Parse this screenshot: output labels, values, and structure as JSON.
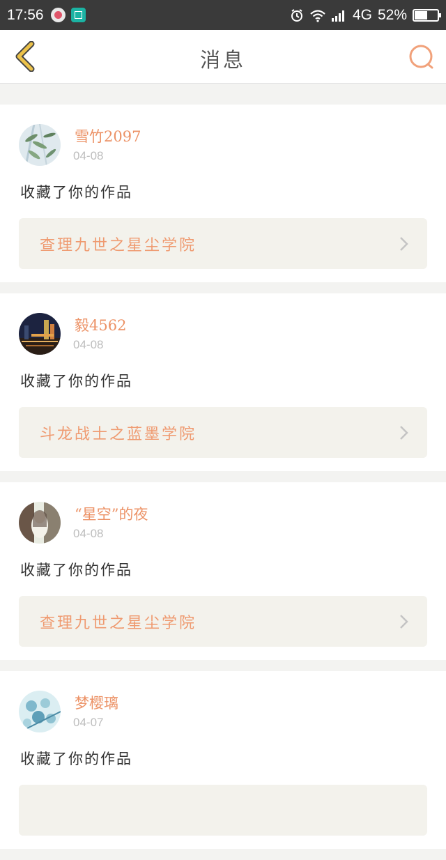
{
  "status_bar": {
    "time": "17:56",
    "network": "4G",
    "battery": "52%"
  },
  "nav": {
    "title": "消息"
  },
  "colors": {
    "accent": "#ec9266",
    "back_arrow": "#ecc24a",
    "search_icon": "#f1a17a"
  },
  "messages": [
    {
      "username": "雪竹2097",
      "date": "04-08",
      "action": "收藏了你的作品",
      "work": "查理九世之星尘学院",
      "avatar_icon": "bamboo-avatar"
    },
    {
      "username": "毅4562",
      "date": "04-08",
      "action": "收藏了你的作品",
      "work": "斗龙战士之蓝墨学院",
      "avatar_icon": "city-night-avatar"
    },
    {
      "username": "“星空”的夜",
      "date": "04-08",
      "action": "收藏了你的作品",
      "work": "查理九世之星尘学院",
      "avatar_icon": "girl-avatar"
    },
    {
      "username": "梦樱璃",
      "date": "04-07",
      "action": "收藏了你的作品",
      "work": "",
      "avatar_icon": "blue-flowers-avatar"
    }
  ]
}
